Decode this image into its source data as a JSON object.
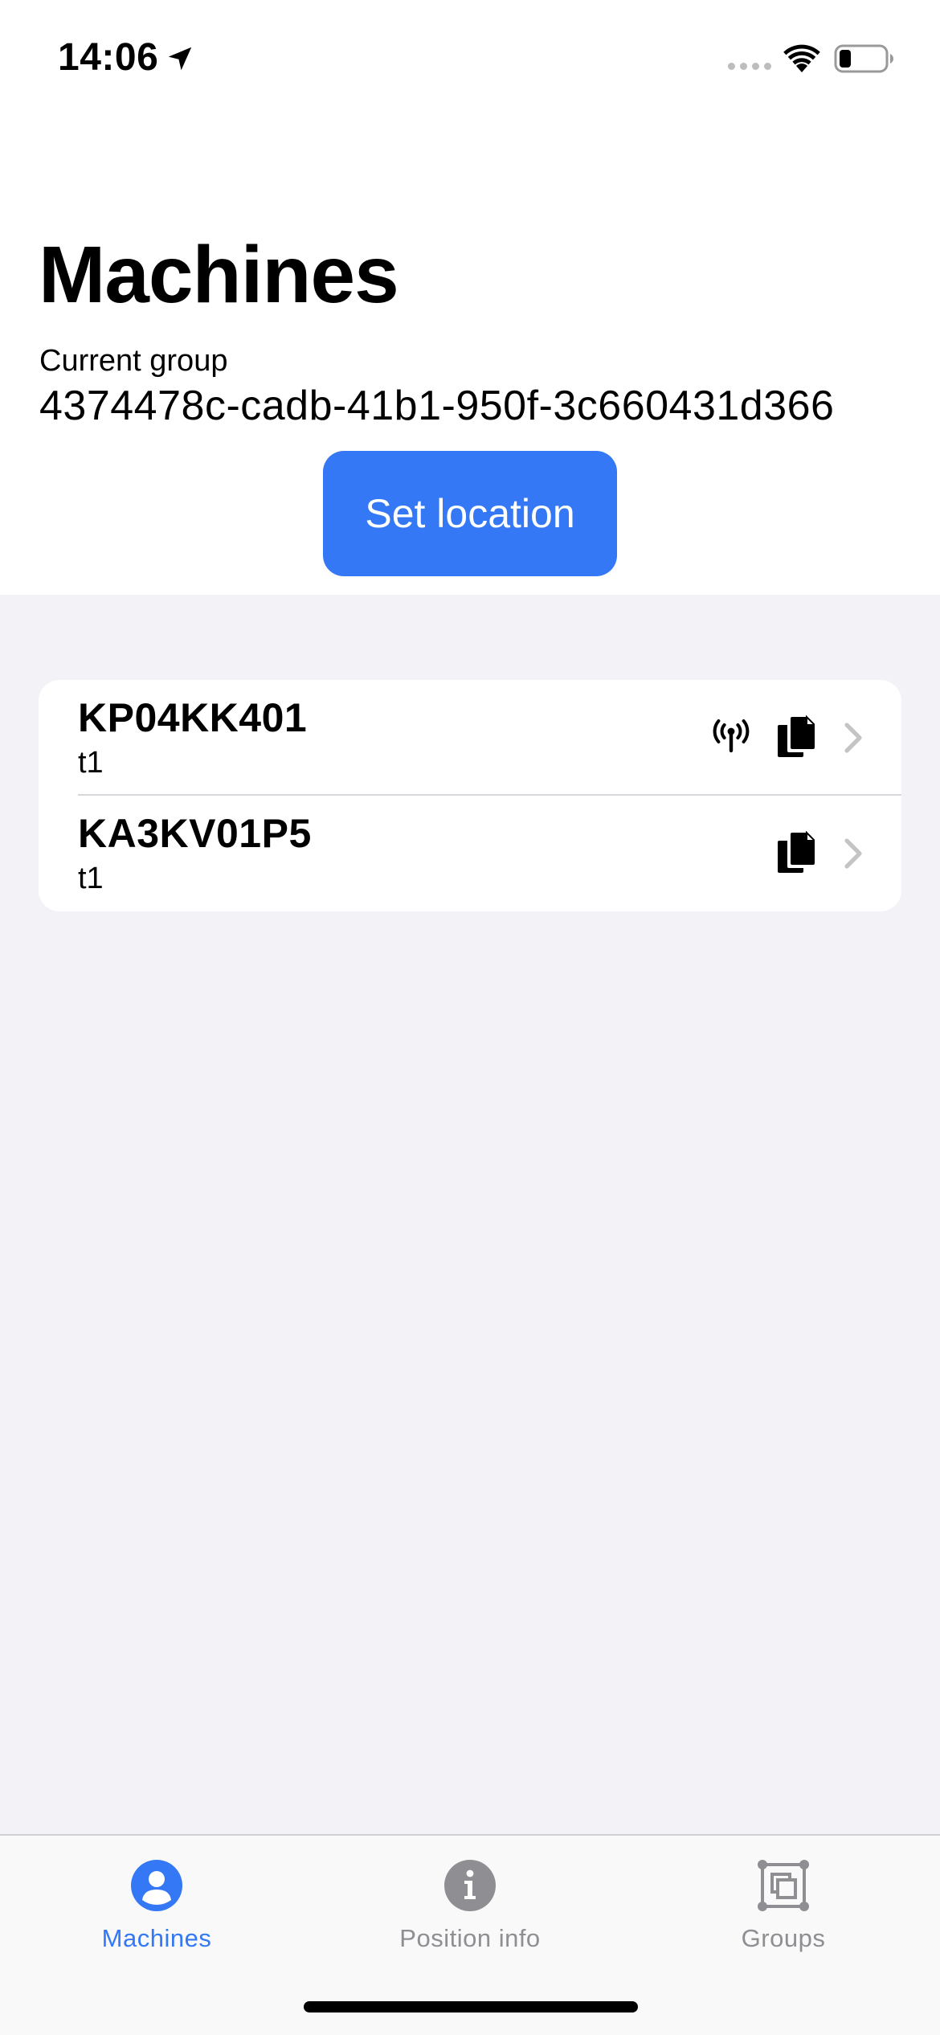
{
  "status_bar": {
    "time": "14:06",
    "icons": [
      "location-arrow-icon",
      "cellular-signal-icon",
      "wifi-icon",
      "battery-icon"
    ]
  },
  "header": {
    "title": "Machines",
    "group_label": "Current group",
    "group_id": "4374478c-cadb-41b1-950f-3c660431d366",
    "set_location_label": "Set location"
  },
  "machines": [
    {
      "name": "KP04KK401",
      "subtitle": "t1",
      "icons": [
        "antenna-icon",
        "documents-icon",
        "chevron-right-icon"
      ]
    },
    {
      "name": "KA3KV01P5",
      "subtitle": "t1",
      "icons": [
        "documents-icon",
        "chevron-right-icon"
      ]
    }
  ],
  "tab_bar": {
    "tabs": [
      {
        "label": "Machines",
        "icon": "person-circle-icon",
        "active": true
      },
      {
        "label": "Position info",
        "icon": "info-circle-icon",
        "active": false
      },
      {
        "label": "Groups",
        "icon": "groups-icon",
        "active": false
      }
    ]
  },
  "colors": {
    "accent": "#3478f6",
    "inactive": "#8e8e93",
    "background": "#f2f2f7"
  }
}
